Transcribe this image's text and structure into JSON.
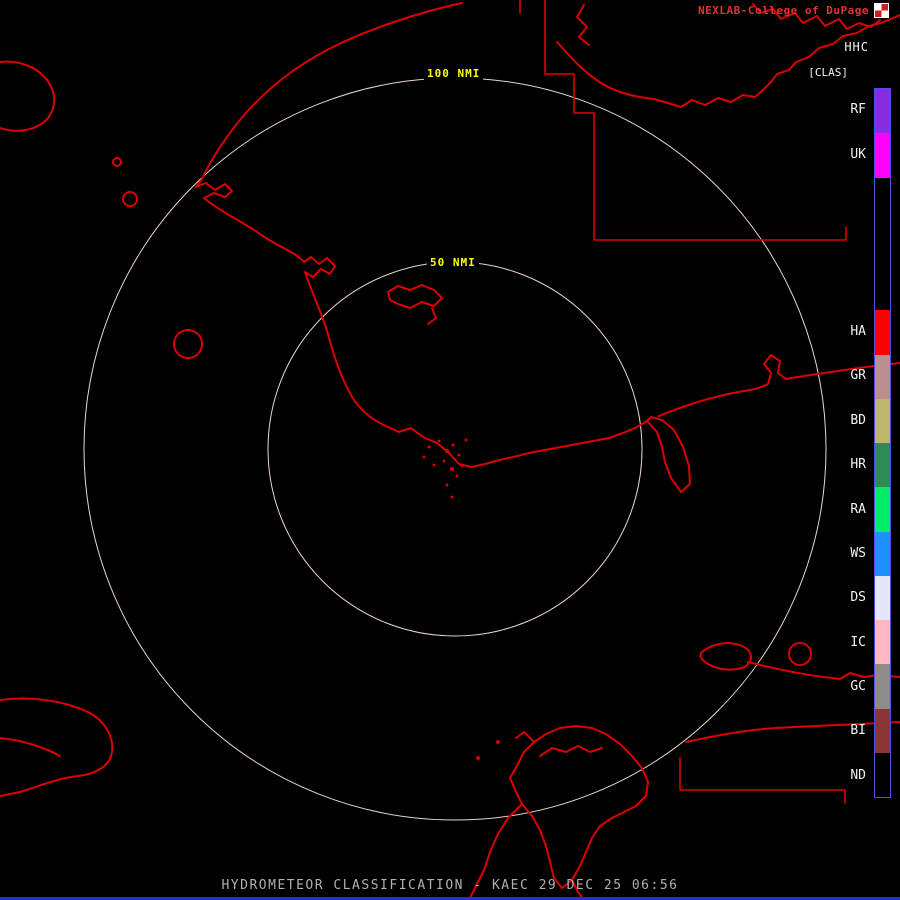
{
  "colors": {
    "background": "#000000",
    "brand_red": "#e13333",
    "header_text": "#f2f2f2",
    "range_label": "#ffff00",
    "map_line": "#dd0000",
    "ring": "#eed5c5",
    "footer_text": "#b0b0b0",
    "bottom_bar": "#2233cc",
    "legend_border": "#5050e0"
  },
  "header": {
    "brand": "NEXLAB-College of DuPage",
    "product_code": "HHC",
    "product_tag": "[CLAS]"
  },
  "range_rings": {
    "outer_label": "100 NMI",
    "inner_label": "50 NMI"
  },
  "legend": {
    "items": [
      {
        "label": "RF",
        "color": "#8a2be2",
        "span": 1
      },
      {
        "label": "UK",
        "color": "#ff00ff",
        "span": 1
      },
      {
        "label": "",
        "color": "#000000",
        "span": 3
      },
      {
        "label": "HA",
        "color": "#ff0000",
        "span": 1
      },
      {
        "label": "GR",
        "color": "#bc8f8f",
        "span": 1
      },
      {
        "label": "BD",
        "color": "#bdb76b",
        "span": 1
      },
      {
        "label": "HR",
        "color": "#2e8b57",
        "span": 1
      },
      {
        "label": "RA",
        "color": "#00ee66",
        "span": 1
      },
      {
        "label": "WS",
        "color": "#1e90ff",
        "span": 1
      },
      {
        "label": "DS",
        "color": "#e6e6fa",
        "span": 1
      },
      {
        "label": "IC",
        "color": "#ffb6c1",
        "span": 1
      },
      {
        "label": "GC",
        "color": "#8c8c8c",
        "span": 1
      },
      {
        "label": "BI",
        "color": "#8b3535",
        "span": 1
      },
      {
        "label": "ND",
        "color": "#000000",
        "span": 1
      }
    ]
  },
  "footer": {
    "status": "HYDROMETEOR CLASSIFICATION - KAEC 29 DEC 25 06:56"
  }
}
